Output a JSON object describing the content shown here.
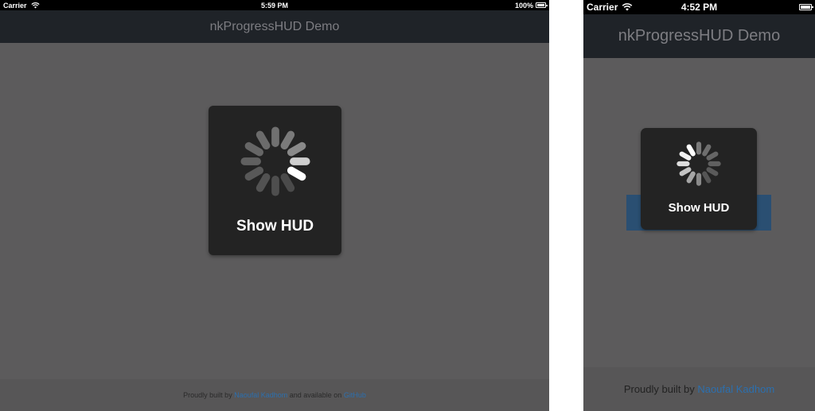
{
  "ipad": {
    "status_bar": {
      "carrier": "Carrier",
      "time": "5:59 PM",
      "battery": "100%"
    },
    "nav_title": "nkProgressHUD Demo",
    "hud_label": "Show HUD",
    "footer": {
      "prefix": "Proudly built by ",
      "author": "Naoufal Kadhom",
      "middle": " and available on ",
      "repo": "GitHub"
    }
  },
  "iphone": {
    "status_bar": {
      "carrier": "Carrier",
      "time": "4:52 PM"
    },
    "nav_title": "nkProgressHUD Demo",
    "hud_label": "Show HUD",
    "footer": {
      "prefix": "Proudly built by ",
      "author": "Naoufal Kadhom"
    }
  },
  "colors": {
    "overlay": "#5c5b5c",
    "navbar": "#1f2328",
    "hud": "#232323",
    "link": "#2c6fae",
    "button_ipad": "#243144",
    "button_iphone": "#2a4f72"
  },
  "icons": {
    "signal": "wifi-icon",
    "battery": "battery-icon",
    "spinner": "activity-spinner-icon"
  }
}
